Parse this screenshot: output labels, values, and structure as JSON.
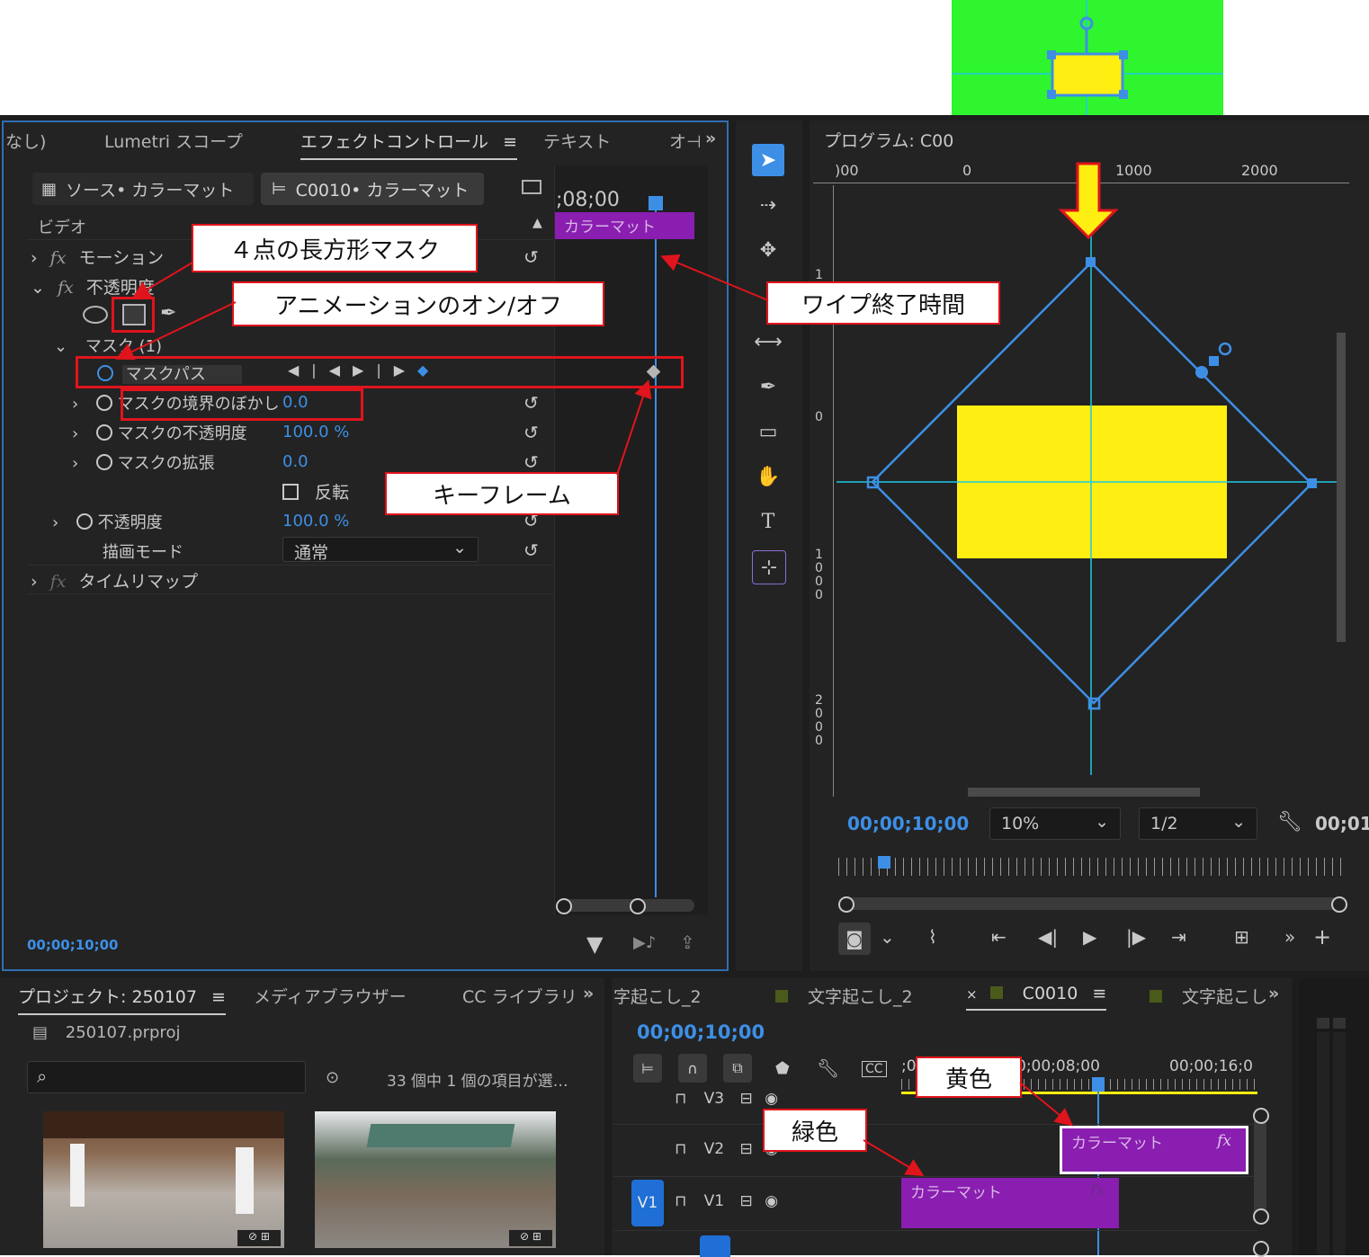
{
  "effect_controls": {
    "tabs": [
      "なし)",
      "Lumetri スコープ",
      "エフェクトコントロール",
      "テキスト",
      "オ⊣"
    ],
    "menu_glyph": "≡",
    "overflow": "»",
    "source_tab": "ソース• カラーマット",
    "clip_tab": "C0010• カラーマット",
    "section_video": "ビデオ",
    "timecode_ruler": ";08;00",
    "clip_bar_label": "カラーマット",
    "motion": "モーション",
    "opacity": "不透明度",
    "mask_group": "マスク (1)",
    "mask_path": "マスクパス",
    "mask_feather_label": "マスクの境界のぼかし",
    "mask_feather_value": "0.0",
    "mask_opacity_label": "マスクの不透明度",
    "mask_opacity_value": "100.0 %",
    "mask_expand_label": "マスクの拡張",
    "mask_expand_value": "0.0",
    "invert_label": "反転",
    "opacity2_label": "不透明度",
    "opacity2_value": "100.0 %",
    "blend_label": "描画モード",
    "blend_value": "通常",
    "time_remap": "タイムリマップ",
    "current_time": "00;00;10;00"
  },
  "program_monitor": {
    "title": "プログラム: C00",
    "ruler_labels": [
      ")00",
      "0",
      "1000",
      "2000"
    ],
    "vruler_labels": [
      "1",
      "0",
      "1\n0\n0\n0",
      "2\n0\n0\n0"
    ],
    "timecode": "00;00;10;00",
    "zoom": "10%",
    "resolution": "1/2",
    "timecode_right": "00;01"
  },
  "project": {
    "tabs": [
      "プロジェクト: 250107",
      "メディアブラウザー",
      "CC ライブラリ"
    ],
    "file": "250107.prproj",
    "status": "33 個中 1 個の項目が選…",
    "search_placeholder": ""
  },
  "timeline": {
    "tabs": [
      "字起こし_2",
      "文字起こし_2",
      "C0010",
      "文字起こし"
    ],
    "close_glyph": "×",
    "timecode": "00;00;10;00",
    "ruler": [
      "0;00;08;00",
      "00;00;16;0"
    ],
    "ruler_left": ";0",
    "tracks": [
      {
        "name": "V3"
      },
      {
        "name": "V2"
      },
      {
        "name": "V1",
        "target": "V1"
      }
    ],
    "clip_v2": "カラーマット",
    "clip_v1": "カラーマット",
    "fx": "fx"
  },
  "callouts": {
    "rect_mask": "４点の長方形マスク",
    "animation_toggle": "アニメーションのオン/オフ",
    "wipe_end": "ワイプ終了時間",
    "keyframe": "キーフレーム",
    "yellow": "黄色",
    "green": "緑色"
  },
  "colors": {
    "accent_blue": "#3d8fe6",
    "clip_purple": "#8a1eb0",
    "callout_red": "#e0141c",
    "matte_yellow": "#ffee11",
    "matte_green": "#2ef52e"
  }
}
